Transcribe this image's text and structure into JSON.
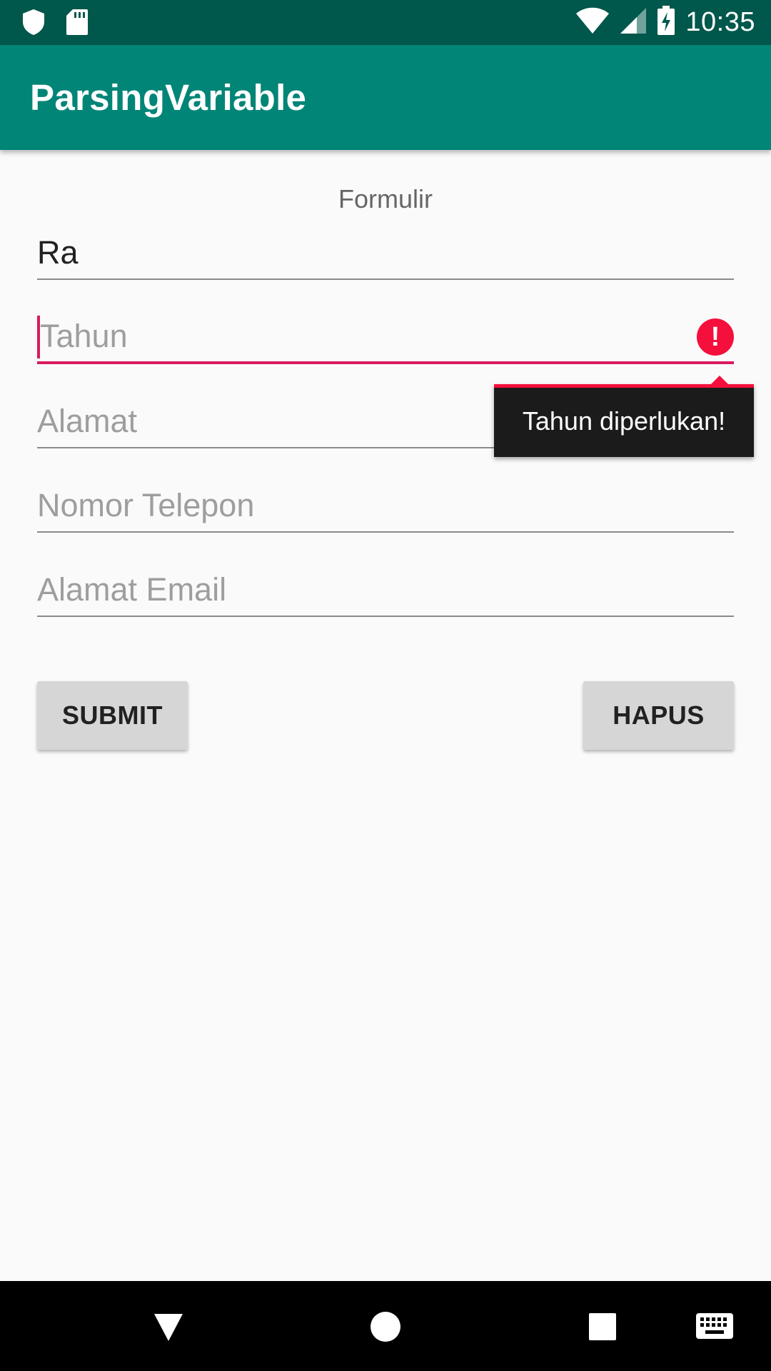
{
  "status_bar": {
    "time": "10:35",
    "icons": [
      "shield-icon",
      "sd-card-icon",
      "wifi-icon",
      "signal-icon",
      "battery-charging-icon"
    ]
  },
  "app_bar": {
    "title": "ParsingVariable",
    "color": "#008577"
  },
  "form": {
    "title": "Formulir",
    "fields": [
      {
        "name": "nama",
        "value": "Ra",
        "placeholder": ""
      },
      {
        "name": "tahun",
        "value": "",
        "placeholder": "Tahun",
        "error": "Tahun diperlukan!"
      },
      {
        "name": "alamat",
        "value": "",
        "placeholder": "Alamat"
      },
      {
        "name": "telepon",
        "value": "",
        "placeholder": "Nomor Telepon"
      },
      {
        "name": "email",
        "value": "",
        "placeholder": "Alamat Email"
      }
    ],
    "submit_label": "SUBMIT",
    "clear_label": "HAPUS"
  },
  "colors": {
    "accent": "#d81b60",
    "error": "#f50f3c",
    "status_bar": "#00574b"
  },
  "nav_bar": {
    "icons": [
      "back-icon",
      "home-icon",
      "recents-icon",
      "keyboard-icon"
    ]
  }
}
